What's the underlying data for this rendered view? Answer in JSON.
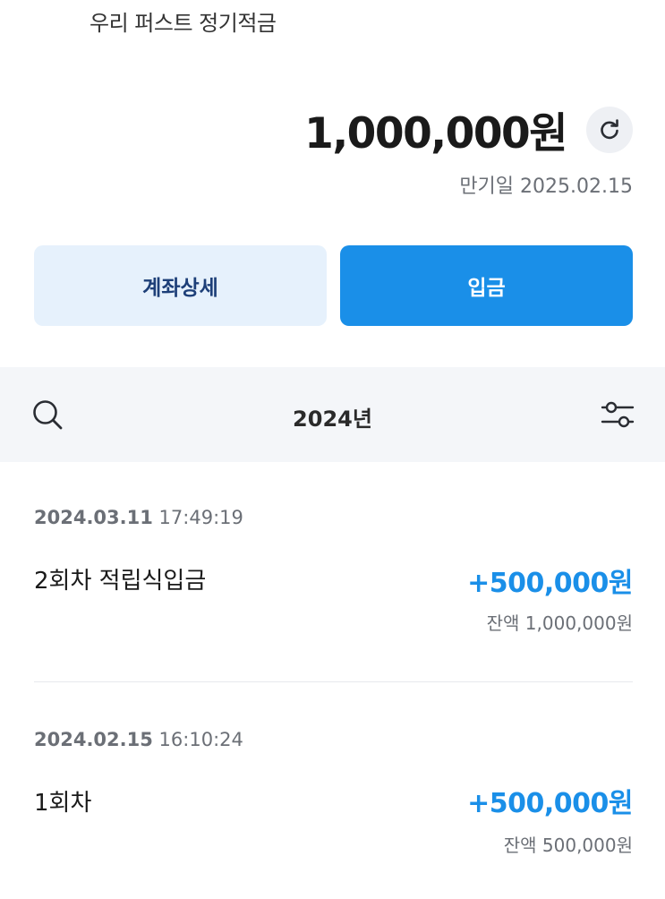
{
  "account": {
    "name": "우리 퍼스트 정기적금",
    "balance": "1,000,000원",
    "maturity": "만기일 2025.02.15"
  },
  "actions": {
    "detail_label": "계좌상세",
    "deposit_label": "입금"
  },
  "filter": {
    "year": "2024년"
  },
  "transactions": [
    {
      "date": "2024.03.11",
      "time": "17:49:19",
      "title": "2회차 적립식입금",
      "amount": "+500,000원",
      "balance": "잔액 1,000,000원"
    },
    {
      "date": "2024.02.15",
      "time": "16:10:24",
      "title": "1회차",
      "amount": "+500,000원",
      "balance": "잔액 500,000원"
    }
  ],
  "colors": {
    "accent": "#1a8fe8",
    "detail_bg": "#e6f1fc",
    "detail_text": "#1d3f78",
    "filter_bar_bg": "#f4f6f9"
  },
  "icons": {
    "refresh": "refresh-icon",
    "search": "search-icon",
    "filter": "filter-sliders-icon"
  }
}
